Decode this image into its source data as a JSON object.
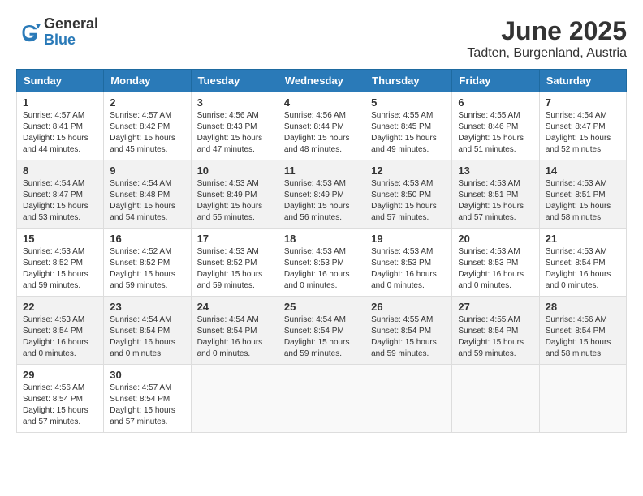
{
  "header": {
    "logo_general": "General",
    "logo_blue": "Blue",
    "title": "June 2025",
    "subtitle": "Tadten, Burgenland, Austria"
  },
  "calendar": {
    "columns": [
      "Sunday",
      "Monday",
      "Tuesday",
      "Wednesday",
      "Thursday",
      "Friday",
      "Saturday"
    ],
    "rows": [
      [
        {
          "day": "1",
          "sunrise": "4:57 AM",
          "sunset": "8:41 PM",
          "daylight": "15 hours and 44 minutes."
        },
        {
          "day": "2",
          "sunrise": "4:57 AM",
          "sunset": "8:42 PM",
          "daylight": "15 hours and 45 minutes."
        },
        {
          "day": "3",
          "sunrise": "4:56 AM",
          "sunset": "8:43 PM",
          "daylight": "15 hours and 47 minutes."
        },
        {
          "day": "4",
          "sunrise": "4:56 AM",
          "sunset": "8:44 PM",
          "daylight": "15 hours and 48 minutes."
        },
        {
          "day": "5",
          "sunrise": "4:55 AM",
          "sunset": "8:45 PM",
          "daylight": "15 hours and 49 minutes."
        },
        {
          "day": "6",
          "sunrise": "4:55 AM",
          "sunset": "8:46 PM",
          "daylight": "15 hours and 51 minutes."
        },
        {
          "day": "7",
          "sunrise": "4:54 AM",
          "sunset": "8:47 PM",
          "daylight": "15 hours and 52 minutes."
        }
      ],
      [
        {
          "day": "8",
          "sunrise": "4:54 AM",
          "sunset": "8:47 PM",
          "daylight": "15 hours and 53 minutes."
        },
        {
          "day": "9",
          "sunrise": "4:54 AM",
          "sunset": "8:48 PM",
          "daylight": "15 hours and 54 minutes."
        },
        {
          "day": "10",
          "sunrise": "4:53 AM",
          "sunset": "8:49 PM",
          "daylight": "15 hours and 55 minutes."
        },
        {
          "day": "11",
          "sunrise": "4:53 AM",
          "sunset": "8:49 PM",
          "daylight": "15 hours and 56 minutes."
        },
        {
          "day": "12",
          "sunrise": "4:53 AM",
          "sunset": "8:50 PM",
          "daylight": "15 hours and 57 minutes."
        },
        {
          "day": "13",
          "sunrise": "4:53 AM",
          "sunset": "8:51 PM",
          "daylight": "15 hours and 57 minutes."
        },
        {
          "day": "14",
          "sunrise": "4:53 AM",
          "sunset": "8:51 PM",
          "daylight": "15 hours and 58 minutes."
        }
      ],
      [
        {
          "day": "15",
          "sunrise": "4:53 AM",
          "sunset": "8:52 PM",
          "daylight": "15 hours and 59 minutes."
        },
        {
          "day": "16",
          "sunrise": "4:52 AM",
          "sunset": "8:52 PM",
          "daylight": "15 hours and 59 minutes."
        },
        {
          "day": "17",
          "sunrise": "4:53 AM",
          "sunset": "8:52 PM",
          "daylight": "15 hours and 59 minutes."
        },
        {
          "day": "18",
          "sunrise": "4:53 AM",
          "sunset": "8:53 PM",
          "daylight": "16 hours and 0 minutes."
        },
        {
          "day": "19",
          "sunrise": "4:53 AM",
          "sunset": "8:53 PM",
          "daylight": "16 hours and 0 minutes."
        },
        {
          "day": "20",
          "sunrise": "4:53 AM",
          "sunset": "8:53 PM",
          "daylight": "16 hours and 0 minutes."
        },
        {
          "day": "21",
          "sunrise": "4:53 AM",
          "sunset": "8:54 PM",
          "daylight": "16 hours and 0 minutes."
        }
      ],
      [
        {
          "day": "22",
          "sunrise": "4:53 AM",
          "sunset": "8:54 PM",
          "daylight": "16 hours and 0 minutes."
        },
        {
          "day": "23",
          "sunrise": "4:54 AM",
          "sunset": "8:54 PM",
          "daylight": "16 hours and 0 minutes."
        },
        {
          "day": "24",
          "sunrise": "4:54 AM",
          "sunset": "8:54 PM",
          "daylight": "16 hours and 0 minutes."
        },
        {
          "day": "25",
          "sunrise": "4:54 AM",
          "sunset": "8:54 PM",
          "daylight": "15 hours and 59 minutes."
        },
        {
          "day": "26",
          "sunrise": "4:55 AM",
          "sunset": "8:54 PM",
          "daylight": "15 hours and 59 minutes."
        },
        {
          "day": "27",
          "sunrise": "4:55 AM",
          "sunset": "8:54 PM",
          "daylight": "15 hours and 59 minutes."
        },
        {
          "day": "28",
          "sunrise": "4:56 AM",
          "sunset": "8:54 PM",
          "daylight": "15 hours and 58 minutes."
        }
      ],
      [
        {
          "day": "29",
          "sunrise": "4:56 AM",
          "sunset": "8:54 PM",
          "daylight": "15 hours and 57 minutes."
        },
        {
          "day": "30",
          "sunrise": "4:57 AM",
          "sunset": "8:54 PM",
          "daylight": "15 hours and 57 minutes."
        },
        null,
        null,
        null,
        null,
        null
      ]
    ]
  }
}
